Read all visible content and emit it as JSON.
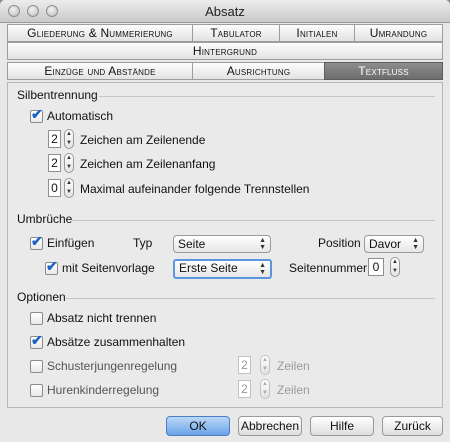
{
  "window": {
    "title": "Absatz"
  },
  "tabs_row1": [
    "Gliederung & Nummerierung",
    "Tabulator",
    "Initialen",
    "Umrandung"
  ],
  "tabs_row2": [
    "Hintergrund"
  ],
  "tabs_row3": [
    "Einzüge und Abstände",
    "Ausrichtung",
    "Textfluss"
  ],
  "active_tab": "Textfluss",
  "silbentrennung": {
    "heading": "Silbentrennung",
    "automatisch": {
      "label": "Automatisch",
      "checked": true
    },
    "zeilenende": {
      "value": "2",
      "label": "Zeichen am Zeilenende"
    },
    "zeilenanfang": {
      "value": "2",
      "label": "Zeichen am Zeilenanfang"
    },
    "trennstellen": {
      "value": "0",
      "label": "Maximal aufeinander folgende Trennstellen"
    }
  },
  "umbrueche": {
    "heading": "Umbrüche",
    "einfuegen": {
      "label": "Einfügen",
      "checked": true
    },
    "typ_label": "Typ",
    "typ_value": "Seite",
    "position_label": "Position",
    "position_value": "Davor",
    "seitenvorlage": {
      "label": "mit Seitenvorlage",
      "checked": true
    },
    "seitenvorlage_value": "Erste Seite",
    "seitennummer_label": "Seitennummer",
    "seitennummer_value": "0"
  },
  "optionen": {
    "heading": "Optionen",
    "nicht_trennen": {
      "label": "Absatz nicht trennen",
      "checked": false
    },
    "zusammenhalten": {
      "label": "Absätze zusammenhalten",
      "checked": true
    },
    "schusterjungen": {
      "label": "Schusterjungenregelung",
      "checked": false,
      "value": "2",
      "unit": "Zeilen"
    },
    "hurenkinder": {
      "label": "Hurenkinderregelung",
      "checked": false,
      "value": "2",
      "unit": "Zeilen"
    }
  },
  "buttons": {
    "ok": "OK",
    "abbrechen": "Abbrechen",
    "hilfe": "Hilfe",
    "zurueck": "Zurück"
  },
  "icons": {
    "check": "✔",
    "up_arrow": "▲",
    "down_arrow": "▼"
  }
}
